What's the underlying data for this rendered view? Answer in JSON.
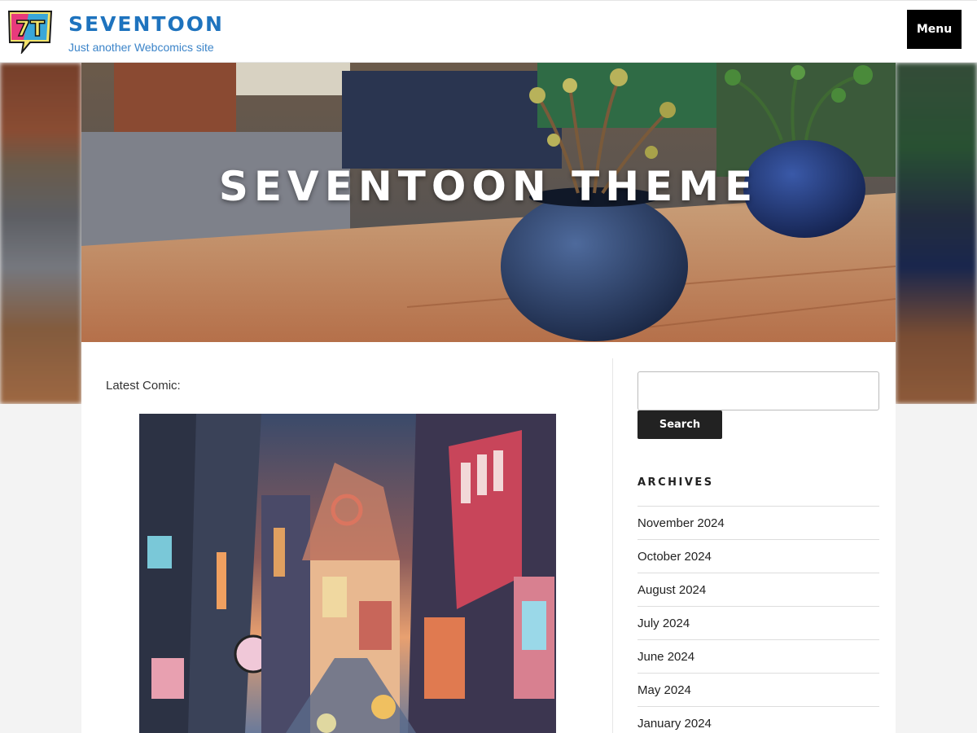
{
  "header": {
    "site_title": "SEVENTOON",
    "site_description": "Just another Webcomics site",
    "menu_label": "Menu",
    "logo_text": "7T"
  },
  "hero": {
    "title": "SEVENTOON THEME"
  },
  "main": {
    "latest_label": "Latest Comic:"
  },
  "sidebar": {
    "search_button_label": "Search",
    "search_value": "",
    "archives_title": "ARCHIVES",
    "archives": [
      "November 2024",
      "October 2024",
      "August 2024",
      "July 2024",
      "June 2024",
      "May 2024",
      "January 2024"
    ]
  },
  "colors": {
    "brand_blue": "#1e73be",
    "menu_bg": "#000000",
    "search_button_bg": "#222222"
  }
}
